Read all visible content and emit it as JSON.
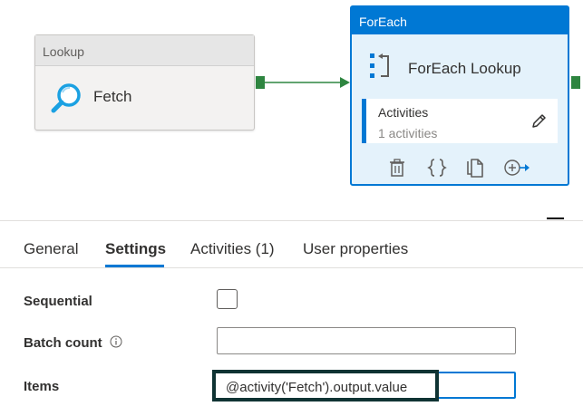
{
  "canvas": {
    "lookup": {
      "header": "Lookup",
      "name": "Fetch",
      "icon": "search-icon"
    },
    "foreach": {
      "header": "ForEach",
      "name": "ForEach Lookup",
      "icon": "foreach-icon",
      "activities_card": {
        "title": "Activities",
        "count": "1 activities"
      },
      "actions": [
        "delete-icon",
        "code-icon",
        "copy-icon",
        "add-output-icon"
      ]
    },
    "colors": {
      "accent": "#0078d4",
      "success_port": "#2e8540",
      "foreach_bg": "#e4f2fb"
    }
  },
  "properties": {
    "tabs": [
      {
        "label": "General",
        "selected": false
      },
      {
        "label": "Settings",
        "selected": true
      },
      {
        "label": "Activities (1)",
        "selected": false
      },
      {
        "label": "User properties",
        "selected": false
      }
    ],
    "settings": {
      "sequential_label": "Sequential",
      "sequential_checked": false,
      "batch_count_label": "Batch count",
      "batch_count_value": "",
      "items_label": "Items",
      "items_value": "@activity('Fetch').output.value"
    }
  }
}
